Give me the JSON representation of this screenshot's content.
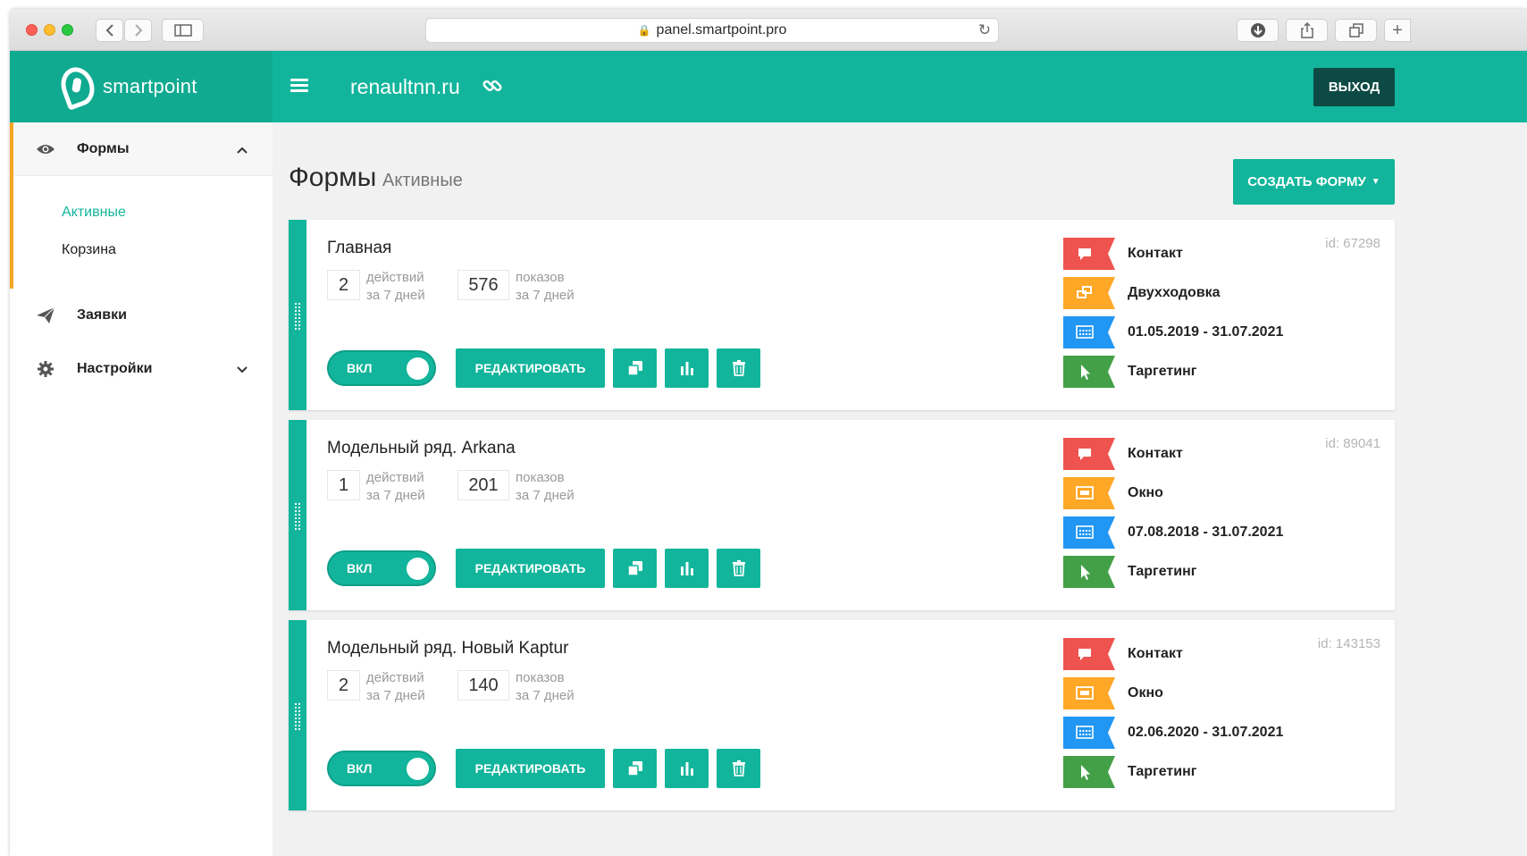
{
  "browser": {
    "url": "panel.smartpoint.pro"
  },
  "header": {
    "logo": "smartpoint",
    "site": "renaultnn.ru",
    "logout": "ВЫХОД"
  },
  "sidebar": {
    "forms": "Формы",
    "active": "Активные",
    "trash": "Корзина",
    "requests": "Заявки",
    "settings": "Настройки"
  },
  "main": {
    "title": "Формы",
    "subtitle": "Активные",
    "create_button": "СОЗДАТЬ ФОРМУ",
    "toggle_label": "ВКЛ",
    "edit_label": "РЕДАКТИРОВАТЬ",
    "actions_label_1": "действий",
    "period_label": "за 7 дней",
    "views_label_1": "показов",
    "cards": [
      {
        "title": "Главная",
        "id": "id: 67298",
        "actions": "2",
        "views": "576",
        "tags": [
          {
            "label": "Контакт",
            "color": "#ef5350",
            "icon": "chat-icon"
          },
          {
            "label": "Двухходовка",
            "color": "#ffa726",
            "icon": "two-step-icon"
          },
          {
            "label": "01.05.2019 - 31.07.2021",
            "color": "#2196f3",
            "icon": "calendar-icon"
          },
          {
            "label": "Таргетинг",
            "color": "#43a047",
            "icon": "cursor-icon"
          }
        ]
      },
      {
        "title": "Модельный ряд. Arkana",
        "id": "id: 89041",
        "actions": "1",
        "views": "201",
        "tags": [
          {
            "label": "Контакт",
            "color": "#ef5350",
            "icon": "chat-icon"
          },
          {
            "label": "Окно",
            "color": "#ffa726",
            "icon": "window-icon"
          },
          {
            "label": "07.08.2018 - 31.07.2021",
            "color": "#2196f3",
            "icon": "calendar-icon"
          },
          {
            "label": "Таргетинг",
            "color": "#43a047",
            "icon": "cursor-icon"
          }
        ]
      },
      {
        "title": "Модельный ряд. Новый Kaptur",
        "id": "id: 143153",
        "actions": "2",
        "views": "140",
        "tags": [
          {
            "label": "Контакт",
            "color": "#ef5350",
            "icon": "chat-icon"
          },
          {
            "label": "Окно",
            "color": "#ffa726",
            "icon": "window-icon"
          },
          {
            "label": "02.06.2020 - 31.07.2021",
            "color": "#2196f3",
            "icon": "calendar-icon"
          },
          {
            "label": "Таргетинг",
            "color": "#43a047",
            "icon": "cursor-icon"
          }
        ]
      }
    ]
  }
}
